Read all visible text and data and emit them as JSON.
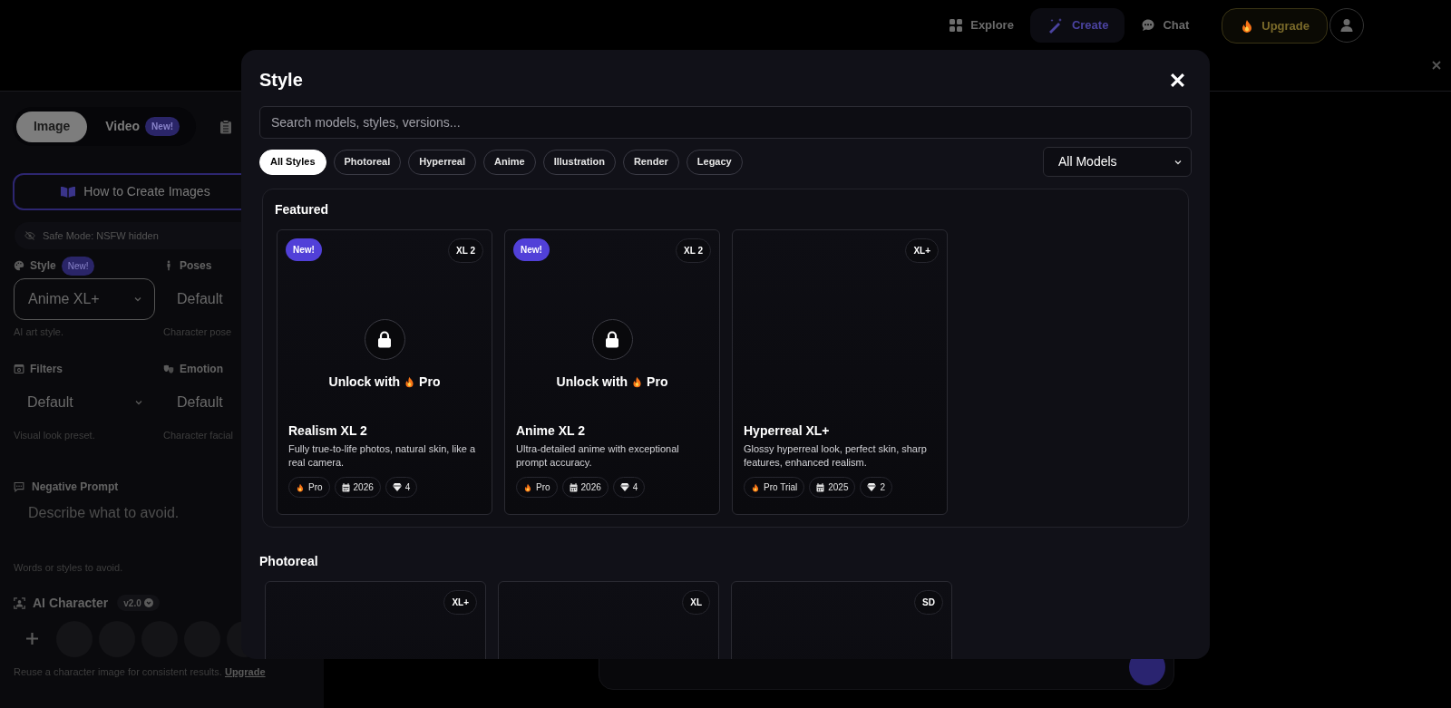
{
  "nav": {
    "items": [
      {
        "kind": "explore",
        "label": "Explore",
        "selected": false
      },
      {
        "kind": "create",
        "label": "Create",
        "selected": true
      },
      {
        "kind": "chat",
        "label": "Chat",
        "selected": false
      }
    ],
    "upgrade": "Upgrade"
  },
  "sidebar": {
    "mode_tabs": [
      {
        "label": "Image",
        "selected": true
      },
      {
        "label": "Video",
        "selected": false,
        "badge": "New!"
      }
    ],
    "guide_button": "How to Create Images",
    "safe_mode": "Safe Mode: NSFW hidden",
    "fields": [
      {
        "kind": "palette",
        "label": "Style",
        "badge": "New!",
        "value": "Anime XL+",
        "boxed": true,
        "help": "AI art style."
      },
      {
        "kind": "pose",
        "label": "Poses",
        "value": "Default",
        "boxed": false,
        "help": "Character pose"
      },
      {
        "kind": "filters",
        "label": "Filters",
        "value": "Default",
        "boxed": false,
        "chevron": true,
        "help": "Visual look preset."
      },
      {
        "kind": "emotion",
        "label": "Emotion",
        "value": "Default",
        "boxed": false,
        "help": "Character facial"
      }
    ],
    "negative_prompt": {
      "label": "Negative Prompt",
      "placeholder": "Describe what to avoid.",
      "help": "Words or styles to avoid."
    },
    "ai_character": {
      "label": "AI Character",
      "version": "v2.0",
      "help": "Reuse a character image for consistent results.",
      "link": "Upgrade"
    }
  },
  "modal": {
    "title": "Style",
    "search": {
      "placeholder": "Search models, styles, versions..."
    },
    "filters": [
      {
        "label": "All Styles",
        "selected": true
      },
      {
        "label": "Photoreal",
        "selected": false
      },
      {
        "label": "Hyperreal",
        "selected": false
      },
      {
        "label": "Anime",
        "selected": false
      },
      {
        "label": "Illustration",
        "selected": false
      },
      {
        "label": "Render",
        "selected": false
      },
      {
        "label": "Legacy",
        "selected": false
      }
    ],
    "model_select": "All Models",
    "sections": [
      {
        "title": "Featured",
        "boxed": true,
        "cards": [
          {
            "new": "New!",
            "tag": "XL 2",
            "locked": true,
            "unlock": "Unlock with",
            "plan": "Pro",
            "name": "Realism XL 2",
            "description": "Fully true-to-life photos, natural skin, like a real camera.",
            "meta": [
              {
                "kind": "plan",
                "text": "Pro"
              },
              {
                "kind": "year",
                "text": "2026"
              },
              {
                "kind": "gems",
                "text": "4"
              }
            ]
          },
          {
            "new": "New!",
            "tag": "XL 2",
            "locked": true,
            "unlock": "Unlock with",
            "plan": "Pro",
            "name": "Anime XL 2",
            "description": "Ultra-detailed anime with exceptional prompt accuracy.",
            "meta": [
              {
                "kind": "plan",
                "text": "Pro"
              },
              {
                "kind": "year",
                "text": "2026"
              },
              {
                "kind": "gems",
                "text": "4"
              }
            ]
          },
          {
            "tag": "XL+",
            "locked": false,
            "name": "Hyperreal XL+",
            "description": "Glossy hyperreal look, perfect skin, sharp features, enhanced realism.",
            "meta": [
              {
                "kind": "plan",
                "text": "Pro Trial"
              },
              {
                "kind": "year",
                "text": "2025"
              },
              {
                "kind": "gems",
                "text": "2"
              }
            ]
          }
        ]
      },
      {
        "title": "Photoreal",
        "boxed": false,
        "cards": [
          {
            "tag": "XL+"
          },
          {
            "tag": "XL"
          },
          {
            "tag": "SD"
          }
        ]
      }
    ]
  }
}
